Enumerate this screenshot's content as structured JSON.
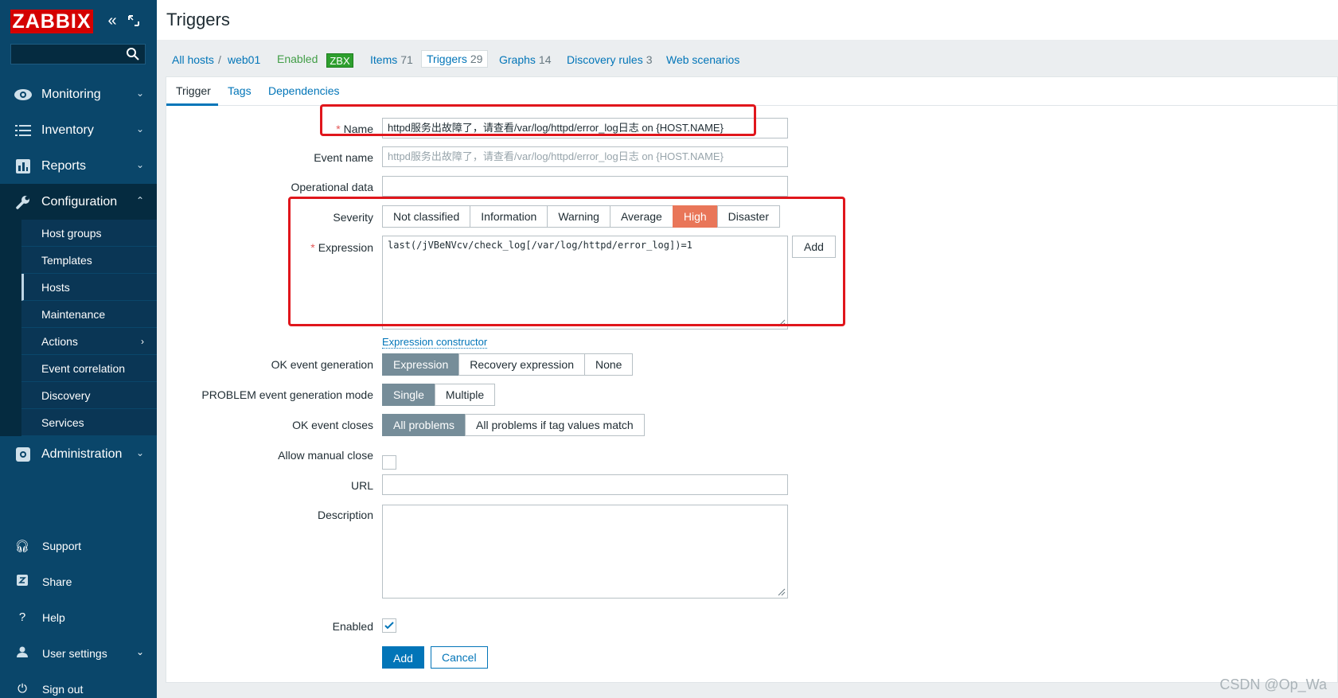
{
  "app": {
    "logo": "ZABBIX",
    "page_title": "Triggers"
  },
  "sidebar": {
    "search_placeholder": "",
    "menu": [
      {
        "label": "Monitoring"
      },
      {
        "label": "Inventory"
      },
      {
        "label": "Reports"
      },
      {
        "label": "Configuration"
      }
    ],
    "config_sub": [
      {
        "label": "Host groups"
      },
      {
        "label": "Templates"
      },
      {
        "label": "Hosts"
      },
      {
        "label": "Maintenance"
      },
      {
        "label": "Actions"
      },
      {
        "label": "Event correlation"
      },
      {
        "label": "Discovery"
      },
      {
        "label": "Services"
      }
    ],
    "administration": "Administration",
    "bottom": [
      {
        "label": "Support"
      },
      {
        "label": "Share"
      },
      {
        "label": "Help"
      },
      {
        "label": "User settings"
      },
      {
        "label": "Sign out"
      }
    ]
  },
  "host_nav": {
    "all_hosts": "All hosts",
    "separator": "/",
    "host": "web01",
    "status": "Enabled",
    "zbx": "ZBX",
    "items_label": "Items",
    "items_count": "71",
    "triggers_label": "Triggers",
    "triggers_count": "29",
    "graphs_label": "Graphs",
    "graphs_count": "14",
    "discovery_label": "Discovery rules",
    "discovery_count": "3",
    "web_label": "Web scenarios"
  },
  "tabs": {
    "trigger": "Trigger",
    "tags": "Tags",
    "dependencies": "Dependencies"
  },
  "form": {
    "name_label": "Name",
    "name_value": "httpd服务出故障了，请查看/var/log/httpd/error_log日志 on {HOST.NAME}",
    "event_name_label": "Event name",
    "event_name_placeholder": "httpd服务出故障了，请查看/var/log/httpd/error_log日志 on {HOST.NAME}",
    "operational_data_label": "Operational data",
    "severity_label": "Severity",
    "severity_options": [
      "Not classified",
      "Information",
      "Warning",
      "Average",
      "High",
      "Disaster"
    ],
    "severity_selected": "High",
    "expression_label": "Expression",
    "expression_value": "last(/jVBeNVcv/check_log[/var/log/httpd/error_log])=1",
    "expression_add": "Add",
    "expression_constructor": "Expression constructor",
    "ok_event_generation_label": "OK event generation",
    "ok_event_generation_options": [
      "Expression",
      "Recovery expression",
      "None"
    ],
    "problem_mode_label": "PROBLEM event generation mode",
    "problem_mode_options": [
      "Single",
      "Multiple"
    ],
    "ok_event_closes_label": "OK event closes",
    "ok_event_closes_options": [
      "All problems",
      "All problems if tag values match"
    ],
    "allow_manual_close_label": "Allow manual close",
    "url_label": "URL",
    "description_label": "Description",
    "enabled_label": "Enabled",
    "add_button": "Add",
    "cancel_button": "Cancel"
  },
  "watermark": "CSDN @Op_Wa",
  "colors": {
    "sidebar": "#0a466a",
    "accent": "#0275b8",
    "high_severity": "#e97659",
    "highlight_box": "#e0161c"
  }
}
